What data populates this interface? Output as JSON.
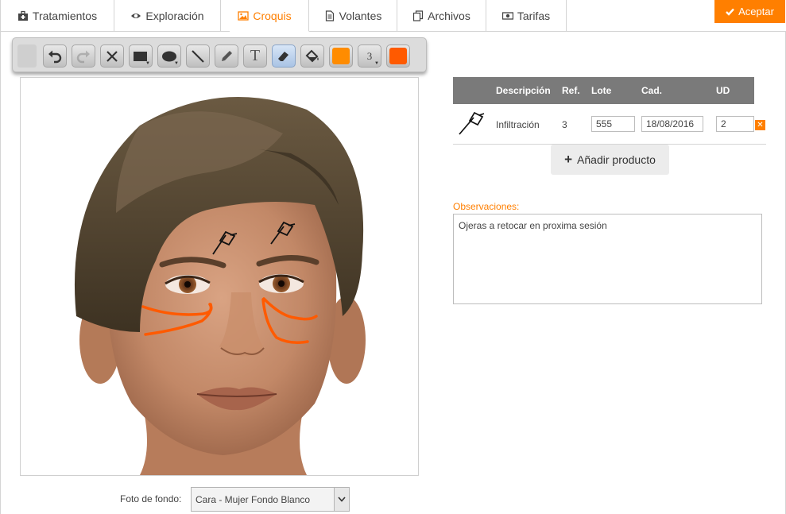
{
  "tabs": [
    {
      "label": "Tratamientos",
      "icon": "medkit-icon"
    },
    {
      "label": "Exploración",
      "icon": "eye-icon"
    },
    {
      "label": "Croquis",
      "icon": "image-icon",
      "active": true
    },
    {
      "label": "Volantes",
      "icon": "document-icon"
    },
    {
      "label": "Archivos",
      "icon": "files-icon"
    },
    {
      "label": "Tarifas",
      "icon": "money-icon"
    }
  ],
  "accept_label": "Aceptar",
  "toolbar": {
    "tools": [
      "undo-icon",
      "redo-icon",
      "delete-icon",
      "rectangle-icon",
      "ellipse-icon",
      "line-icon",
      "pencil-icon",
      "text-icon",
      "eraser-icon",
      "fill-icon"
    ],
    "text_tool_glyph": "T",
    "fill_color": "#ff8c00",
    "stroke_width": "3",
    "stroke_color": "#ff5a00"
  },
  "table": {
    "headers": {
      "descripcion": "Descripción",
      "ref": "Ref.",
      "lote": "Lote",
      "cad": "Cad.",
      "ud": "UD"
    },
    "rows": [
      {
        "icon": "syringe-icon",
        "descripcion": "Infiltración",
        "ref": "3",
        "lote": "555",
        "cad": "18/08/2016",
        "ud": "2"
      }
    ]
  },
  "add_product_label": "Añadir producto",
  "observaciones": {
    "label": "Observaciones:",
    "value": "Ojeras a retocar en proxima sesión"
  },
  "background": {
    "label": "Foto de fondo:",
    "selected": "Cara - Mujer Fondo Blanco"
  },
  "colors": {
    "accent": "#ff7f00",
    "table_header": "#7a7a7a",
    "annotation": "#ff5a00"
  }
}
